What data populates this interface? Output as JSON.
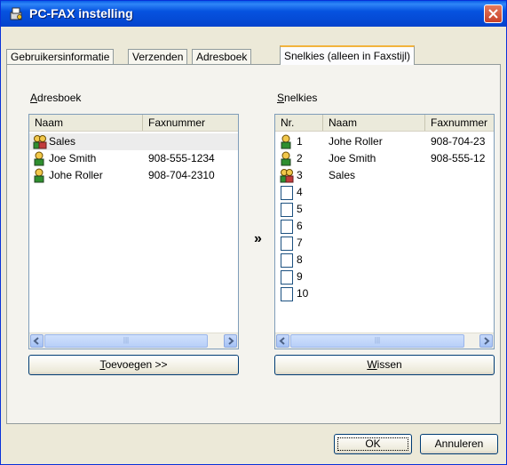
{
  "window": {
    "title": "PC-FAX instelling",
    "icon": "fax-settings-icon"
  },
  "tabs": [
    {
      "label": "Gebruikersinformatie",
      "active": false
    },
    {
      "label": "Verzenden",
      "active": false
    },
    {
      "label": "Adresboek",
      "active": false
    },
    {
      "label": "Snelkies (alleen in Faxstijl)",
      "active": true
    }
  ],
  "addressbook": {
    "label_access": "A",
    "label_rest": "dresboek",
    "columns": [
      "Naam",
      "Faxnummer"
    ],
    "rows": [
      {
        "name": "Sales",
        "fax": "",
        "icon": "group-icon",
        "selected": true
      },
      {
        "name": "Joe Smith",
        "fax": "908-555-1234",
        "icon": "person-icon",
        "selected": false
      },
      {
        "name": "Johe Roller",
        "fax": "908-704-2310",
        "icon": "person-icon",
        "selected": false
      }
    ],
    "add_button_access": "T",
    "add_button_rest": "oevoegen >>"
  },
  "mover_glyph": "»",
  "speeddial": {
    "label_access": "S",
    "label_rest": "nelkies",
    "columns": [
      "Nr.",
      "Naam",
      "Faxnummer"
    ],
    "rows": [
      {
        "nr": "1",
        "name": "Johe Roller",
        "fax": "908-704-23",
        "icon": "person-icon"
      },
      {
        "nr": "2",
        "name": "Joe Smith",
        "fax": "908-555-12",
        "icon": "person-icon"
      },
      {
        "nr": "3",
        "name": "Sales",
        "fax": "",
        "icon": "group-icon"
      },
      {
        "nr": "4",
        "name": "",
        "fax": "",
        "icon": "empty-checkbox"
      },
      {
        "nr": "5",
        "name": "",
        "fax": "",
        "icon": "empty-checkbox"
      },
      {
        "nr": "6",
        "name": "",
        "fax": "",
        "icon": "empty-checkbox"
      },
      {
        "nr": "7",
        "name": "",
        "fax": "",
        "icon": "empty-checkbox"
      },
      {
        "nr": "8",
        "name": "",
        "fax": "",
        "icon": "empty-checkbox"
      },
      {
        "nr": "9",
        "name": "",
        "fax": "",
        "icon": "empty-checkbox"
      },
      {
        "nr": "10",
        "name": "",
        "fax": "",
        "icon": "empty-checkbox"
      }
    ],
    "clear_button_access": "W",
    "clear_button_rest": "issen"
  },
  "footer": {
    "ok_label": "OK",
    "cancel_label": "Annuleren"
  },
  "colors": {
    "titlebar": "#0653e0",
    "close_button": "#c8422a",
    "active_tab_accent": "#f2b33d",
    "dialog_background": "#ece9d8"
  }
}
